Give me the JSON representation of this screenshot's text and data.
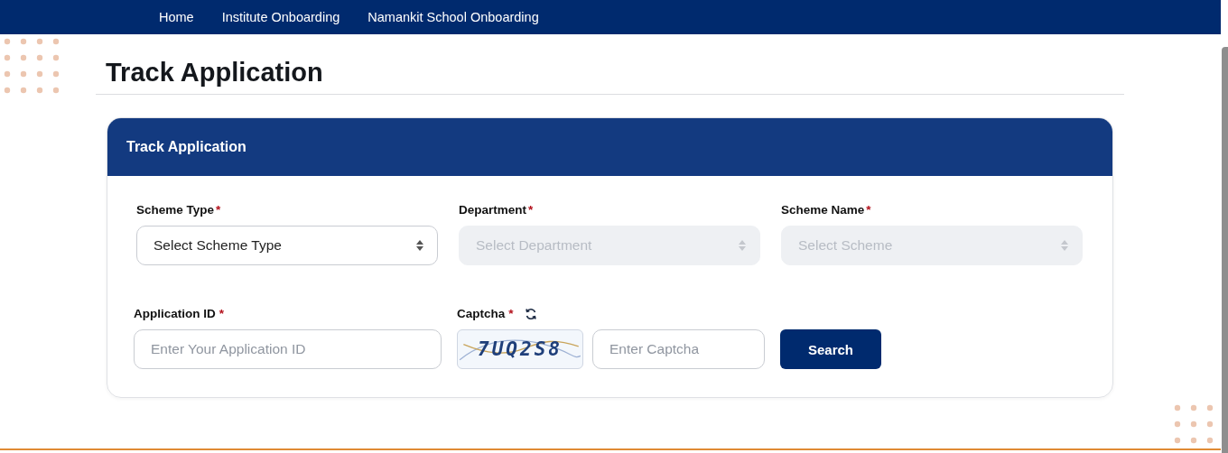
{
  "nav": {
    "items": [
      {
        "label": "Home"
      },
      {
        "label": "Institute Onboarding"
      },
      {
        "label": "Namankit School Onboarding"
      }
    ]
  },
  "page_title": "Track Application",
  "card": {
    "title": "Track Application",
    "selects": [
      {
        "label": "Scheme Type",
        "required_mark": "*",
        "placeholder": "Select Scheme Type",
        "disabled": false
      },
      {
        "label": "Department",
        "required_mark": "*",
        "placeholder": "Select Department",
        "disabled": true
      },
      {
        "label": "Scheme Name",
        "required_mark": "*",
        "placeholder": "Select Scheme",
        "disabled": true
      }
    ],
    "application_id": {
      "label": "Application ID",
      "required_mark": "*",
      "placeholder": "Enter Your Application ID"
    },
    "captcha": {
      "label": "Captcha",
      "required_mark": "*",
      "code": "7UQ2S8",
      "placeholder": "Enter Captcha"
    },
    "search_button": "Search"
  }
}
